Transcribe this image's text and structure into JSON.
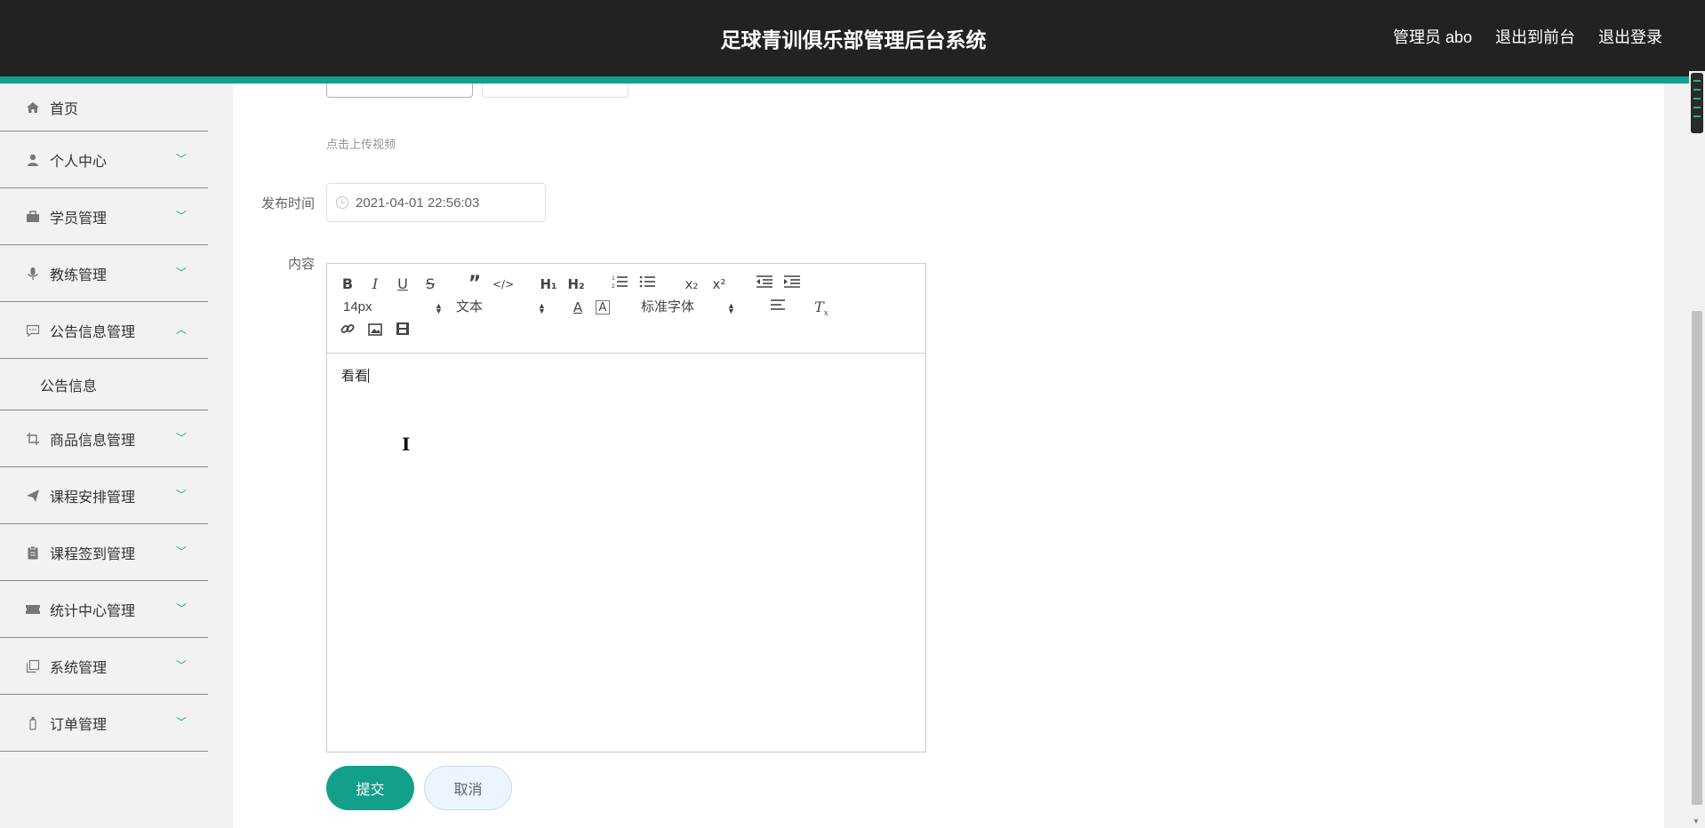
{
  "header": {
    "title": "足球青训俱乐部管理后台系统",
    "admin_label": "管理员 abo",
    "to_front": "退出到前台",
    "logout": "退出登录"
  },
  "sidebar": {
    "items": [
      {
        "label": "首页",
        "icon": "home-icon"
      },
      {
        "label": "个人中心",
        "icon": "user-icon"
      },
      {
        "label": "学员管理",
        "icon": "briefcase-icon"
      },
      {
        "label": "教练管理",
        "icon": "microphone-icon"
      },
      {
        "label": "公告信息管理",
        "icon": "message-icon",
        "expanded": true,
        "children": [
          "公告信息"
        ]
      },
      {
        "label": "商品信息管理",
        "icon": "crop-icon"
      },
      {
        "label": "课程安排管理",
        "icon": "send-icon"
      },
      {
        "label": "课程签到管理",
        "icon": "clipboard-icon"
      },
      {
        "label": "统计中心管理",
        "icon": "ticket-icon"
      },
      {
        "label": "系统管理",
        "icon": "copy-icon"
      },
      {
        "label": "订单管理",
        "icon": "bottle-icon"
      }
    ]
  },
  "form": {
    "upload_video_link": "点击上传视频",
    "publish_time_label": "发布时间",
    "publish_time_value": "2021-04-01 22:56:03",
    "content_label": "内容",
    "editor": {
      "font_size": "14px",
      "header_select": "文本",
      "font_family": "标准字体",
      "content": "看看"
    },
    "submit_label": "提交",
    "cancel_label": "取消"
  },
  "colors": {
    "accent": "#12a08a",
    "header_bg": "#222222"
  }
}
